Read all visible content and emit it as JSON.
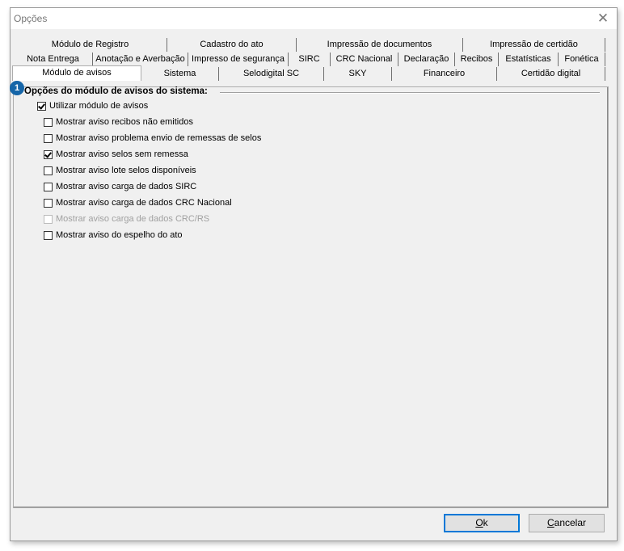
{
  "window": {
    "title": "Opções",
    "close_glyph": "✕"
  },
  "tabs": {
    "row1": [
      "Módulo de Registro",
      "Cadastro do ato",
      "Impressão de documentos",
      "Impressão de certidão"
    ],
    "row2": [
      "Nota Entrega",
      "Anotação e Averbação",
      "Impresso de segurança",
      "SIRC",
      "CRC Nacional",
      "Declaração",
      "Recibos",
      "Estatísticas",
      "Fonética"
    ],
    "row3": [
      "Módulo de avisos",
      "Sistema",
      "Selodigital SC",
      "SKY",
      "Financeiro",
      "Certidão digital"
    ],
    "selected": "Módulo de avisos"
  },
  "group": {
    "badge": "1",
    "title": "Opções do módulo de avisos do sistema:"
  },
  "options": [
    {
      "label": "Utilizar módulo de avisos",
      "checked": true,
      "disabled": false
    },
    {
      "label": "Mostrar aviso recibos não emitidos",
      "checked": false,
      "disabled": false
    },
    {
      "label": "Mostrar aviso problema envio de remessas de selos",
      "checked": false,
      "disabled": false
    },
    {
      "label": "Mostrar aviso selos sem remessa",
      "checked": true,
      "disabled": false
    },
    {
      "label": "Mostrar aviso lote selos disponíveis",
      "checked": false,
      "disabled": false
    },
    {
      "label": "Mostrar aviso carga de dados SIRC",
      "checked": false,
      "disabled": false
    },
    {
      "label": "Mostrar aviso carga de dados CRC Nacional",
      "checked": false,
      "disabled": false
    },
    {
      "label": "Mostrar aviso carga de dados CRC/RS",
      "checked": false,
      "disabled": true
    },
    {
      "label": "Mostrar aviso do espelho do ato",
      "checked": false,
      "disabled": false
    }
  ],
  "buttons": {
    "ok_mnemonic": "O",
    "ok_rest": "k",
    "cancel_mnemonic": "C",
    "cancel_rest": "ancelar"
  },
  "colors": {
    "badge": "#1565a8",
    "default_button_border": "#0078d7"
  }
}
